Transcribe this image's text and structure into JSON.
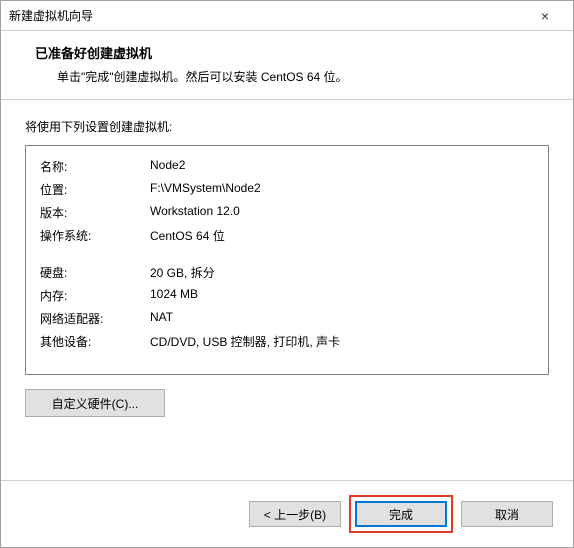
{
  "titlebar": {
    "title": "新建虚拟机向导",
    "close": "×"
  },
  "header": {
    "title": "已准备好创建虚拟机",
    "subtitle": "单击\"完成\"创建虚拟机。然后可以安装 CentOS 64 位。"
  },
  "content": {
    "intro": "将使用下列设置创建虚拟机:"
  },
  "settings": {
    "rows1": [
      {
        "label": "名称:",
        "value": "Node2"
      },
      {
        "label": "位置:",
        "value": "F:\\VMSystem\\Node2"
      },
      {
        "label": "版本:",
        "value": "Workstation 12.0"
      },
      {
        "label": "操作系统:",
        "value": "CentOS 64 位"
      }
    ],
    "rows2": [
      {
        "label": "硬盘:",
        "value": "20 GB, 拆分"
      },
      {
        "label": "内存:",
        "value": "1024 MB"
      },
      {
        "label": "网络适配器:",
        "value": "NAT"
      },
      {
        "label": "其他设备:",
        "value": "CD/DVD, USB 控制器, 打印机, 声卡"
      }
    ]
  },
  "buttons": {
    "customize": "自定义硬件(C)...",
    "back": "< 上一步(B)",
    "finish": "完成",
    "cancel": "取消"
  }
}
